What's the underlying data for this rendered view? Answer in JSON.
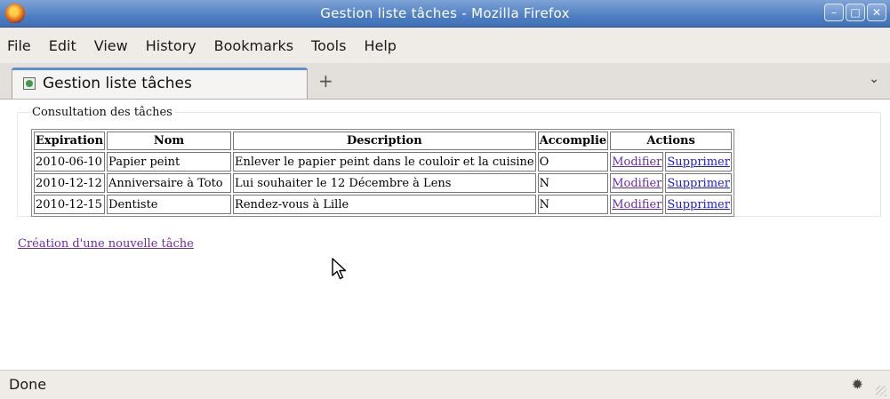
{
  "window": {
    "title": "Gestion liste tâches - Mozilla Firefox",
    "controls": [
      "minimize",
      "maximize",
      "close"
    ]
  },
  "menubar": {
    "items": [
      "File",
      "Edit",
      "View",
      "History",
      "Bookmarks",
      "Tools",
      "Help"
    ]
  },
  "tabs": {
    "active_label": "Gestion liste tâches",
    "new_tab_glyph": "+"
  },
  "page": {
    "legend": "Consultation des tâches",
    "table": {
      "headers": [
        "Expiration",
        "Nom",
        "Description",
        "Accomplie",
        "Actions"
      ],
      "rows": [
        {
          "expiration": "2010-06-10",
          "nom": "Papier peint",
          "description": "Enlever le papier peint dans le couloir et la cuisine",
          "accomplie": "O",
          "modifier": "Modifier",
          "supprimer": "Supprimer"
        },
        {
          "expiration": "2010-12-12",
          "nom": "Anniversaire à Toto",
          "description": "Lui souhaiter le 12 Décembre à Lens",
          "accomplie": "N",
          "modifier": "Modifier",
          "supprimer": "Supprimer"
        },
        {
          "expiration": "2010-12-15",
          "nom": "Dentiste",
          "description": "Rendez-vous à Lille",
          "accomplie": "N",
          "modifier": "Modifier",
          "supprimer": "Supprimer"
        }
      ]
    },
    "create_link": "Création d'une nouvelle tâche"
  },
  "statusbar": {
    "text": "Done"
  },
  "colors": {
    "titlebar": "#4f7fc2",
    "visited_link": "#6a2ba8",
    "link": "#1a1ae0"
  }
}
